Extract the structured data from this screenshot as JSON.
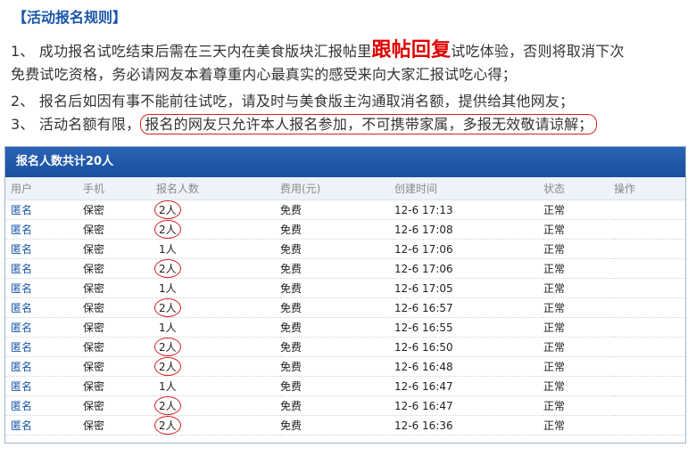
{
  "rules": {
    "title": "【活动报名规则】",
    "r1_prefix": "1、 成功报名试吃结束后需在三天内在美食版块汇报帖里",
    "r1_highlight": "跟帖回复",
    "r1_suffix": "试吃体验，否则将取消下次",
    "r1_cont": "免费试吃资格，务必请网友本着尊重内心最真实的感受来向大家汇报试吃心得；",
    "r2": "2、 报名后如因有事不能前往试吃，请及时与美食版主沟通取消名额，提供给其他网友；",
    "r3_prefix": "3、 活动名额有限，",
    "r3_boxed": "报名的网友只允许本人报名参加，不可携带家属，多报无效敬请谅解；"
  },
  "panel": {
    "title": "报名人数共计20人",
    "columns": [
      "用户",
      "手机",
      "报名人数",
      "费用(元)",
      "创建时间",
      "状态",
      "操作"
    ],
    "rows": [
      {
        "user": "匿名",
        "phone": "保密",
        "count": "2人",
        "circled": true,
        "fee": "免费",
        "time": "12-6 17:13",
        "status": "正常"
      },
      {
        "user": "匿名",
        "phone": "保密",
        "count": "2人",
        "circled": true,
        "fee": "免费",
        "time": "12-6 17:08",
        "status": "正常"
      },
      {
        "user": "匿名",
        "phone": "保密",
        "count": "1人",
        "circled": false,
        "fee": "免费",
        "time": "12-6 17:06",
        "status": "正常"
      },
      {
        "user": "匿名",
        "phone": "保密",
        "count": "2人",
        "circled": true,
        "fee": "免费",
        "time": "12-6 17:06",
        "status": "正常"
      },
      {
        "user": "匿名",
        "phone": "保密",
        "count": "1人",
        "circled": false,
        "fee": "免费",
        "time": "12-6 17:05",
        "status": "正常"
      },
      {
        "user": "匿名",
        "phone": "保密",
        "count": "2人",
        "circled": true,
        "fee": "免费",
        "time": "12-6 16:57",
        "status": "正常"
      },
      {
        "user": "匿名",
        "phone": "保密",
        "count": "1人",
        "circled": false,
        "fee": "免费",
        "time": "12-6 16:55",
        "status": "正常"
      },
      {
        "user": "匿名",
        "phone": "保密",
        "count": "2人",
        "circled": true,
        "fee": "免费",
        "time": "12-6 16:50",
        "status": "正常"
      },
      {
        "user": "匿名",
        "phone": "保密",
        "count": "2人",
        "circled": true,
        "fee": "免费",
        "time": "12-6 16:48",
        "status": "正常"
      },
      {
        "user": "匿名",
        "phone": "保密",
        "count": "1人",
        "circled": false,
        "fee": "免费",
        "time": "12-6 16:47",
        "status": "正常"
      },
      {
        "user": "匿名",
        "phone": "保密",
        "count": "2人",
        "circled": true,
        "fee": "免费",
        "time": "12-6 16:47",
        "status": "正常"
      },
      {
        "user": "匿名",
        "phone": "保密",
        "count": "2人",
        "circled": true,
        "fee": "免费",
        "time": "12-6 16:36",
        "status": "正常"
      }
    ]
  },
  "colors": {
    "title_blue": "#1a56a8",
    "highlight_red": "#e00000",
    "annotation_red": "#d42020",
    "header_bar": "#1a4f9f"
  }
}
